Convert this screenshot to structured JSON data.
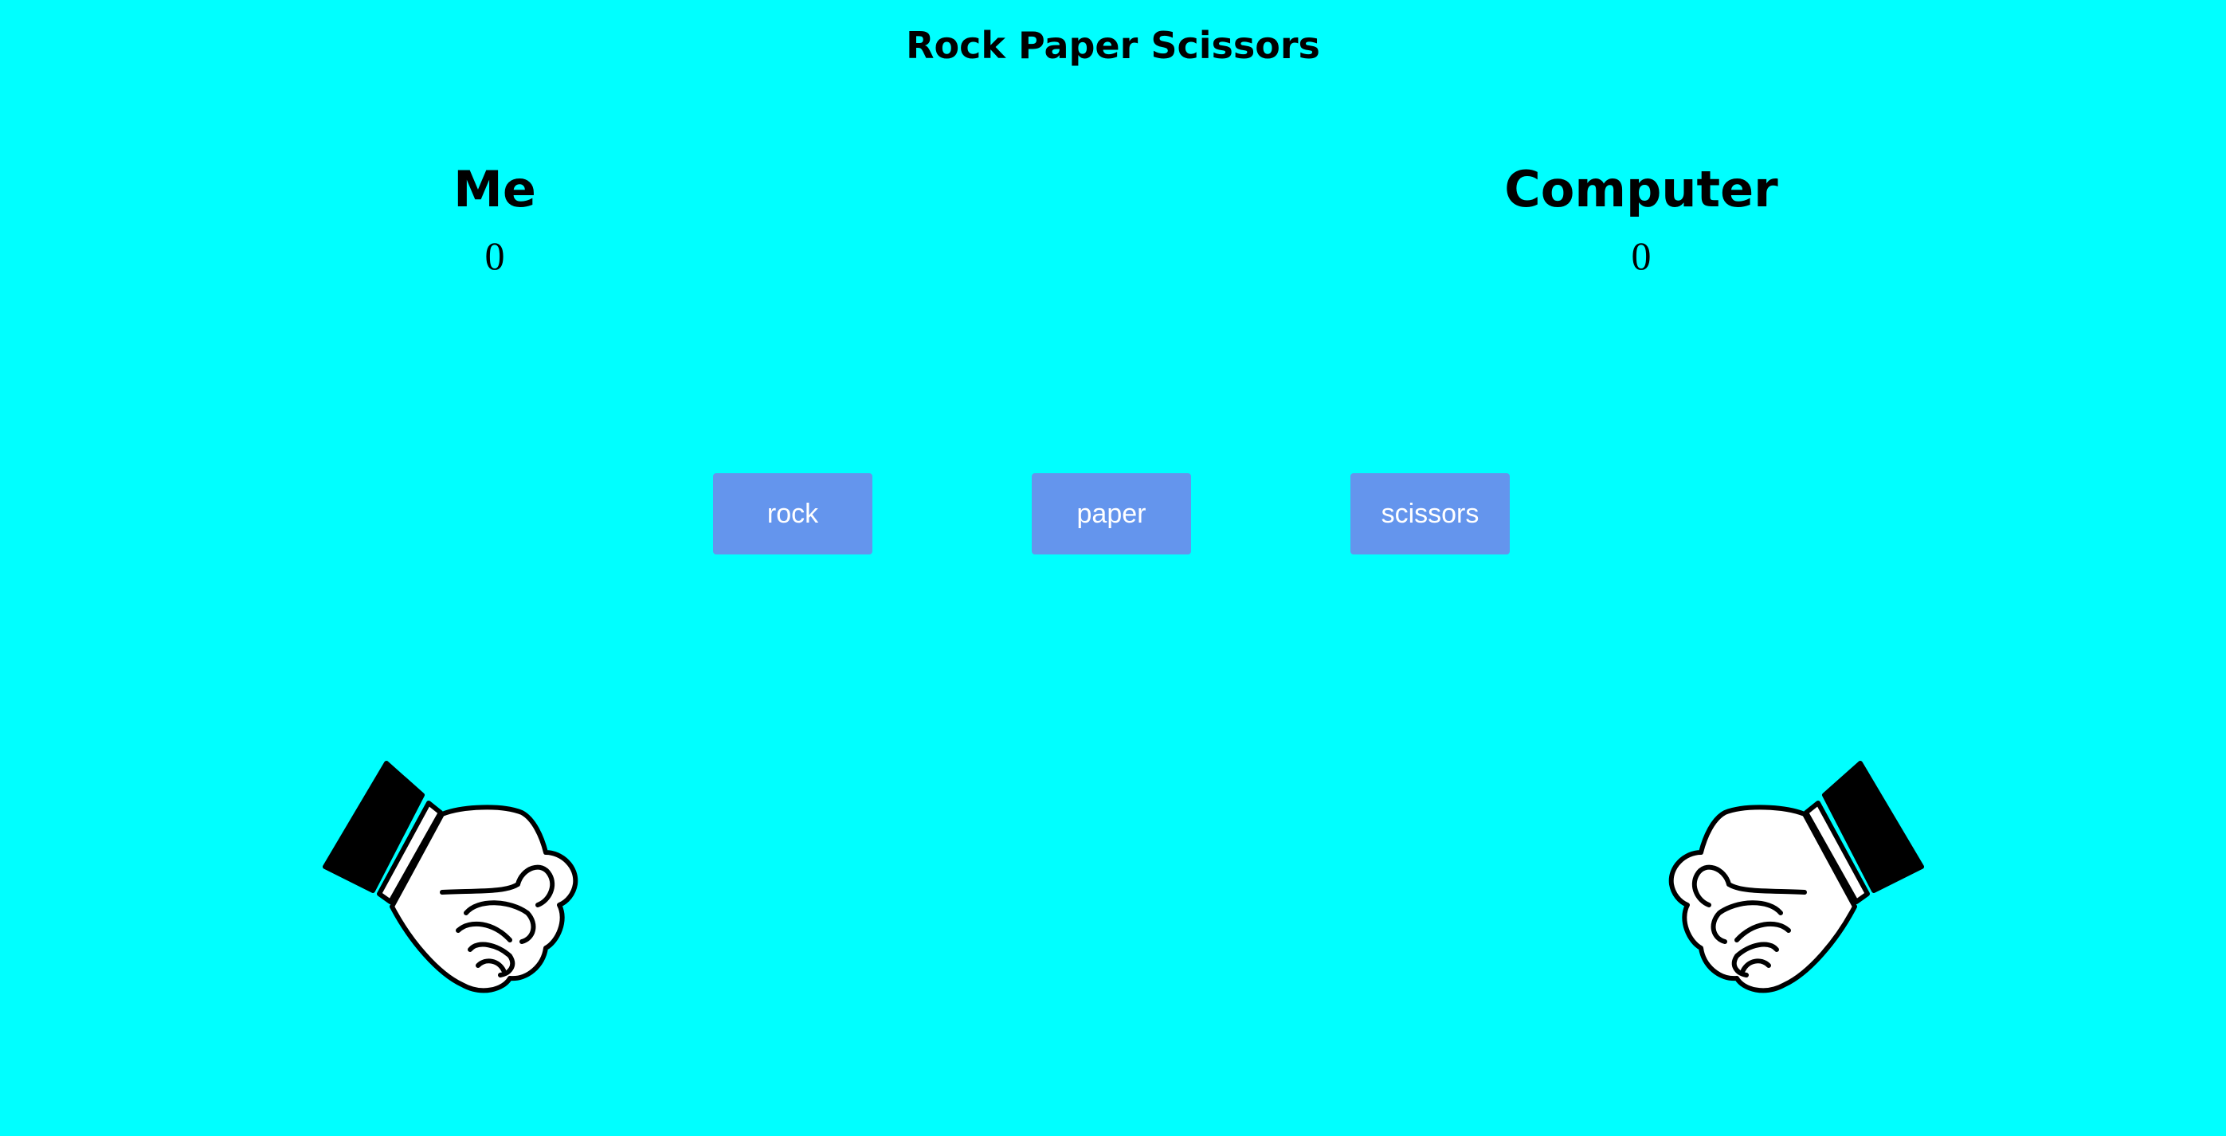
{
  "game": {
    "title": "Rock Paper Scissors"
  },
  "players": {
    "me": {
      "name": "Me",
      "score": "0",
      "hand": "rock-fist-icon"
    },
    "computer": {
      "name": "Computer",
      "score": "0",
      "hand": "rock-fist-icon"
    }
  },
  "choices": {
    "rock": "rock",
    "paper": "paper",
    "scissors": "scissors"
  },
  "colors": {
    "background": "#00ffff",
    "button": "#6495ed",
    "button_text": "#ffffff"
  }
}
